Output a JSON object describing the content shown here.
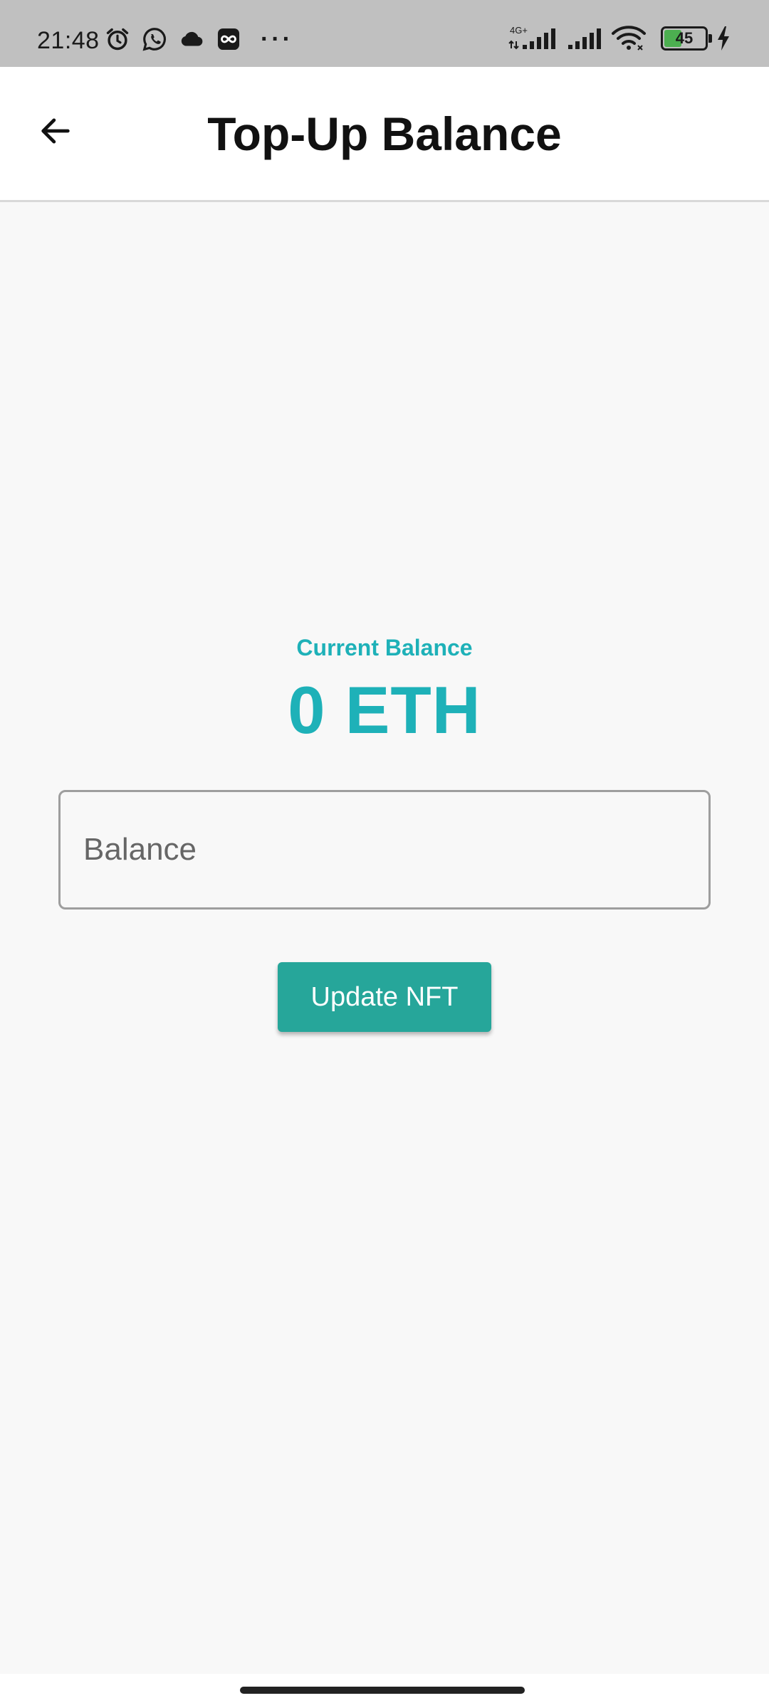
{
  "status_bar": {
    "time": "21:48",
    "left_icons": [
      "alarm-icon",
      "whatsapp-icon",
      "cloud-icon",
      "infinity-app-icon"
    ],
    "more": "···",
    "network_label": "4G+",
    "battery_level": "45",
    "charging": true
  },
  "app_bar": {
    "title": "Top-Up Balance",
    "back_icon": "arrow-left-icon"
  },
  "balance": {
    "label": "Current Balance",
    "value": "0 ETH"
  },
  "form": {
    "input_placeholder": "Balance",
    "input_value": "",
    "button_label": "Update NFT"
  },
  "colors": {
    "accent": "#1eb1b8",
    "button": "#26a69a",
    "status_bar": "#c0c0c0",
    "battery_fill": "#4caf50"
  }
}
